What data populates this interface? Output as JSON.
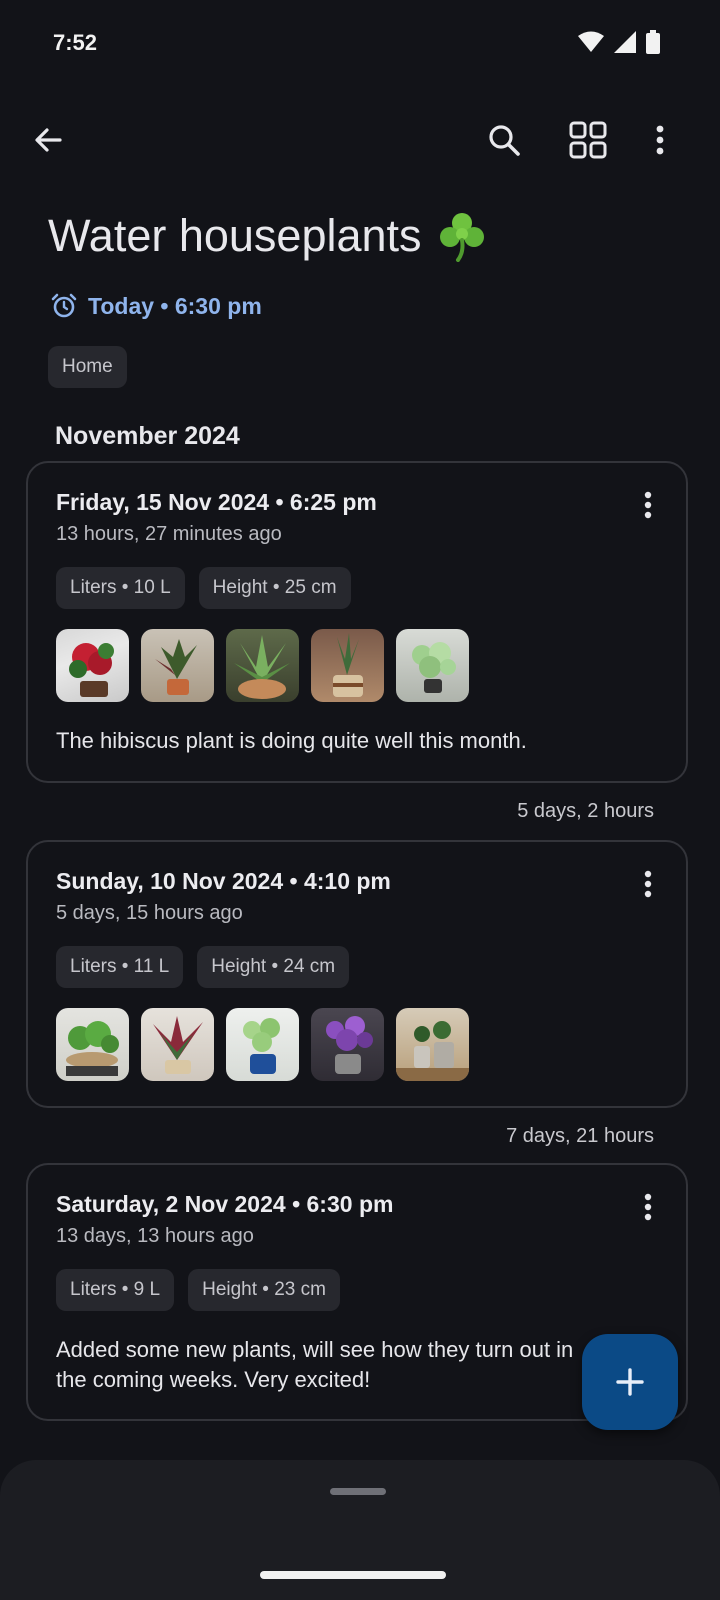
{
  "status_bar": {
    "time": "7:52"
  },
  "header": {
    "title": "Water houseplants",
    "title_icon": "shamrock-icon",
    "reminder": "Today • 6:30 pm",
    "tag": "Home"
  },
  "month_heading": "November 2024",
  "entries": [
    {
      "date": "Friday, 15 Nov 2024 • 6:25 pm",
      "ago": "13 hours, 27 minutes ago",
      "chips": [
        "Liters • 10 L",
        "Height • 25 cm"
      ],
      "photo_count": 5,
      "note": "The hibiscus plant is doing quite well this month."
    },
    {
      "date": "Sunday, 10 Nov 2024 • 4:10 pm",
      "ago": "5 days, 15 hours ago",
      "chips": [
        "Liters • 11 L",
        "Height • 24 cm"
      ],
      "photo_count": 5,
      "note": ""
    },
    {
      "date": "Saturday, 2 Nov 2024 • 6:30 pm",
      "ago": "13 days, 13 hours ago",
      "chips": [
        "Liters • 9 L",
        "Height • 23 cm"
      ],
      "photo_count": 0,
      "note_line1": "Added some new plants, will see how they turn out in",
      "note_line2": "the coming weeks. Very excited!"
    }
  ],
  "gaps": [
    "5 days, 2 hours",
    "7 days, 21 hours"
  ],
  "fab_icon": "plus-icon",
  "colors": {
    "background": "#121318",
    "accent": "#8fb4ec",
    "fab": "#0b4a86"
  }
}
